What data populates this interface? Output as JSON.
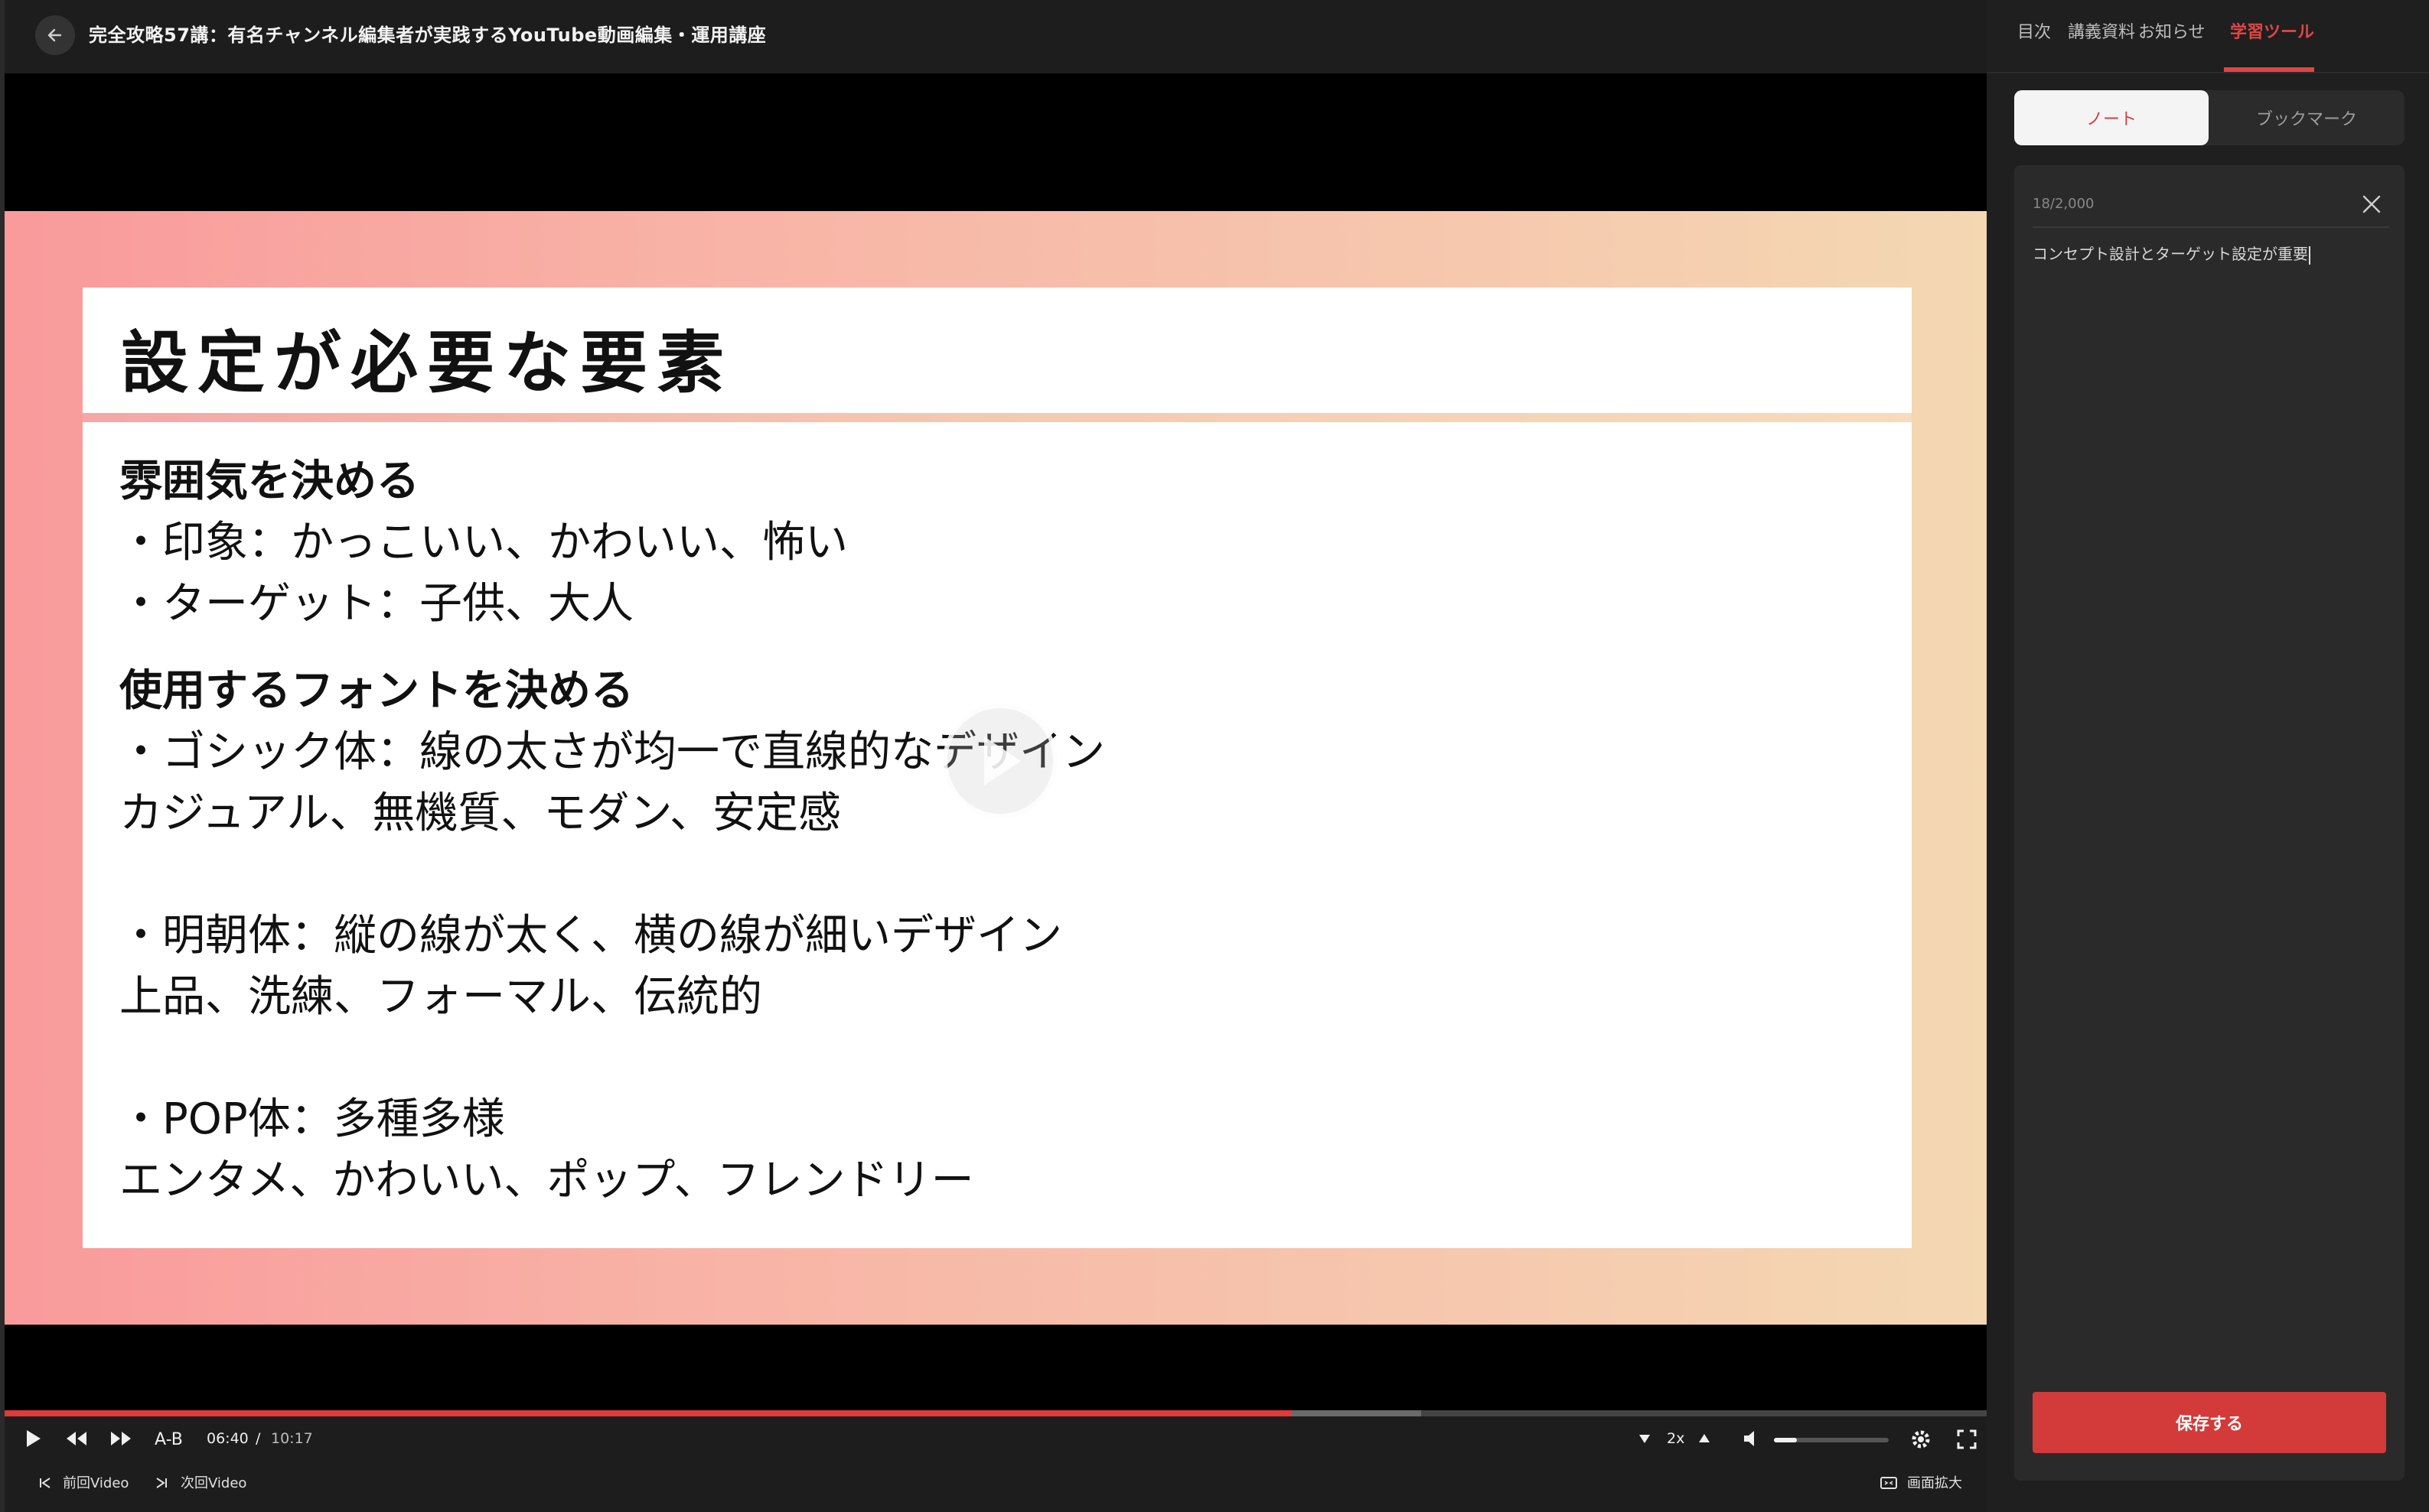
{
  "header": {
    "course_title": "完全攻略57講：有名チャンネル編集者が実践するYouTube動画編集・運用講座"
  },
  "slide": {
    "title": "設定が必要な要素",
    "sections": [
      {
        "heading": "雰囲気を決める",
        "lines": [
          "・印象：かっこいい、かわいい、怖い",
          "・ターゲット：子供、大人"
        ]
      },
      {
        "heading": "使用するフォントを決める",
        "lines": [
          "・ゴシック体：線の太さが均一で直線的なデザイン",
          "カジュアル、無機質、モダン、安定感",
          "",
          "・明朝体：縦の線が太く、横の線が細いデザイン",
          "上品、洗練、フォーマル、伝統的",
          "",
          "・POP体：多種多様",
          "エンタメ、かわいい、ポップ、フレンドリー"
        ]
      }
    ]
  },
  "player": {
    "ab_label": "A-B",
    "current_time": "06:40",
    "separator": "/",
    "duration": "10:17",
    "speed": "2x",
    "progress_fraction": 0.648,
    "buffered_fraction": 0.713,
    "volume_fraction": 0.2,
    "prev_video": "前回Video",
    "next_video": "次回Video",
    "expand_screen": "画面拡大"
  },
  "sidebar": {
    "tabs": [
      "目次",
      "講義資料",
      "お知らせ",
      "学習ツール"
    ],
    "active_tab": "学習ツール",
    "segment": {
      "note": "ノート",
      "bookmark": "ブックマーク"
    },
    "note": {
      "count": "18/2,000",
      "text": "コンセプト設計とターゲット設定が重要",
      "save_label": "保存する"
    }
  },
  "colors": {
    "accent": "#e04545",
    "save": "#d33a3a",
    "progress": "#e03a3a"
  }
}
